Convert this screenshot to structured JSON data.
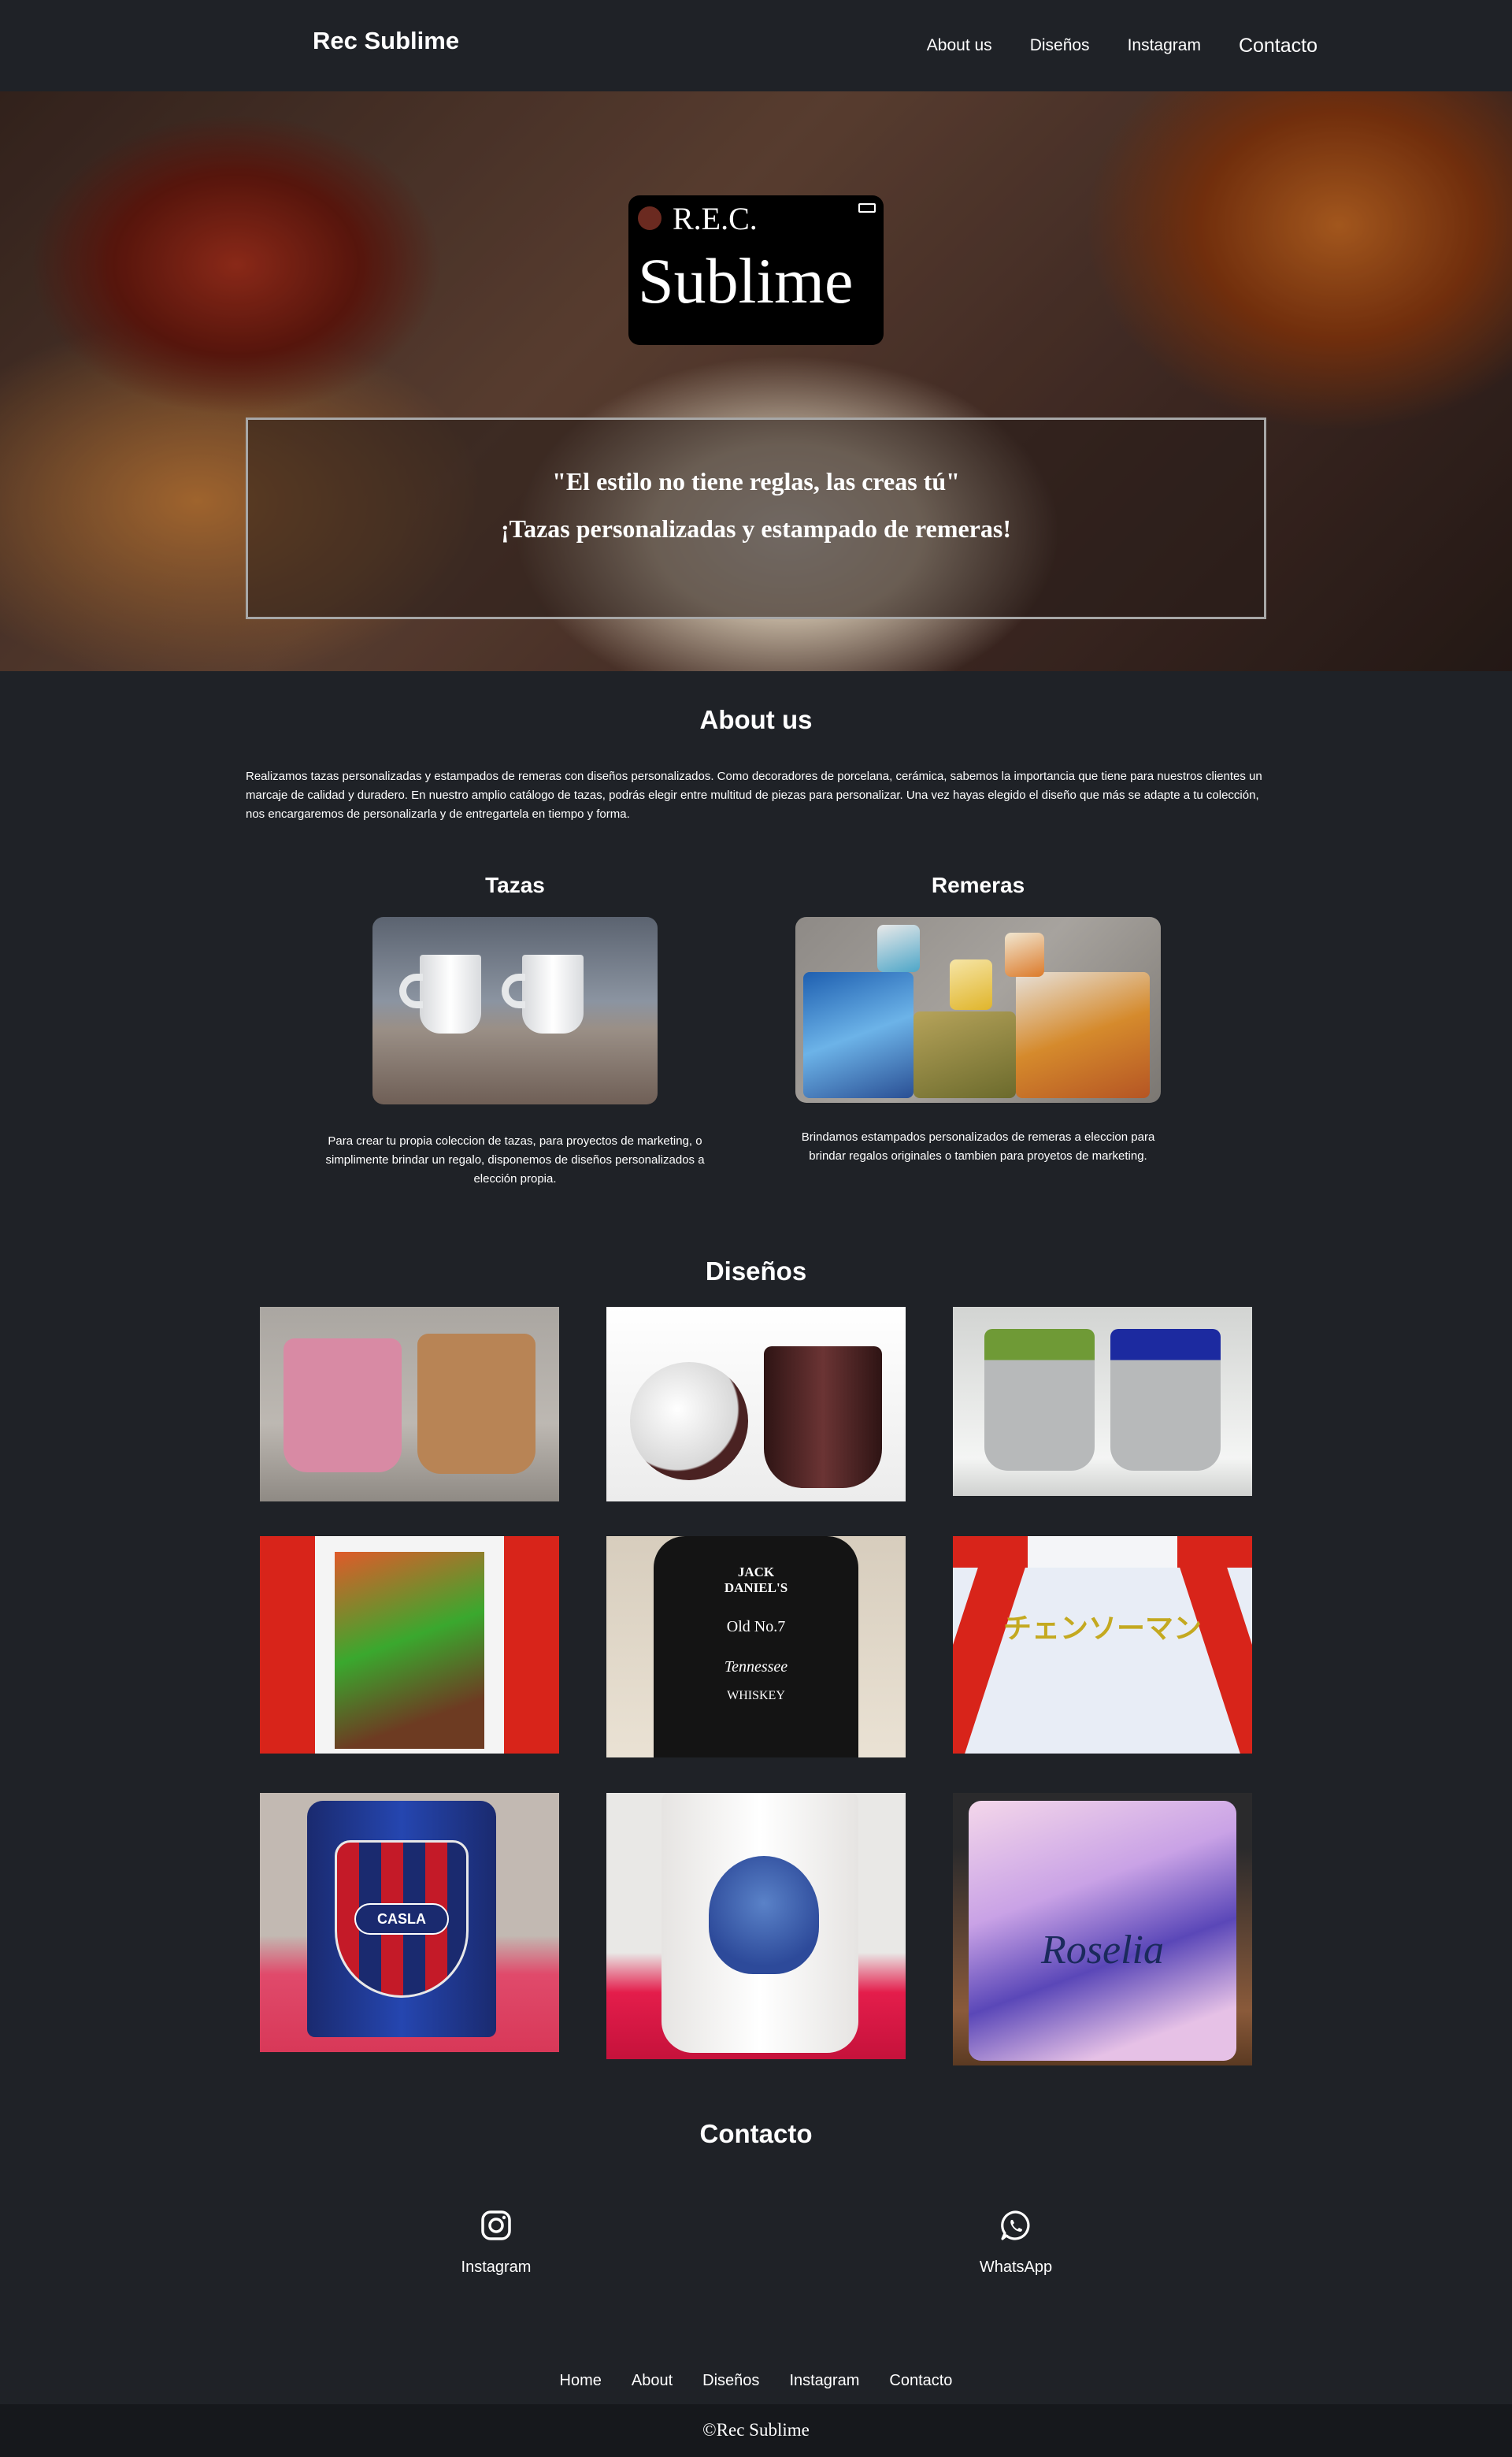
{
  "navbar": {
    "brand": "Rec Sublime",
    "links": [
      "About us",
      "Diseños",
      "Instagram",
      "Contacto"
    ]
  },
  "hero": {
    "logo_small": "R.E.C.",
    "logo_big": "Sublime",
    "tagline_1": "\"El estilo no tiene reglas, las creas tú\"",
    "tagline_2": "¡Tazas personalizadas y estampado de remeras!"
  },
  "about": {
    "title": "About us",
    "text": "Realizamos tazas personalizadas y estampados de remeras con diseños personalizados. Como decoradores de porcelana, cerámica, sabemos la importancia que tiene para nuestros clientes un marcaje de calidad y duradero. En nuestro amplio catálogo de tazas, podrás elegir entre multitud de piezas para personalizar. Una vez hayas elegido el diseño que más se adapte a tu colección, nos encargaremos de personalizarla y de entregartela en tiempo y forma.",
    "tazas": {
      "title": "Tazas",
      "text": "Para crear tu propia coleccion de tazas, para proyectos de marketing, o simplimente brindar un regalo, disponemos de diseños personalizados a elección propia."
    },
    "remeras": {
      "title": "Remeras",
      "text": "Brindamos estampados personalizados de remeras a eleccion para brindar regalos originales o tambien para proyetos de marketing."
    }
  },
  "disenos": {
    "title": "Diseños",
    "gallery_text": {
      "jack_line1": "JACK DANIEL'S",
      "jack_line2": "Old No.7",
      "jack_line3": "Tennessee",
      "jack_line4": "WHISKEY",
      "katakana": "チェンソーマン",
      "casla": "CASLA",
      "roselia": "Roselia"
    },
    "colors": {
      "pink_mug": "#d88aa4",
      "cork_mug": "#b88455",
      "brown_mug": "#4a2222",
      "green_inner": "#6f9a36",
      "blue_inner": "#1c2aa0",
      "red_sleeve": "#d8241a"
    }
  },
  "contacto": {
    "title": "Contacto",
    "items": [
      {
        "label": "Instagram",
        "icon": "instagram-icon"
      },
      {
        "label": "WhatsApp",
        "icon": "whatsapp-icon"
      }
    ]
  },
  "footer": {
    "links": [
      "Home",
      "About",
      "Diseños",
      "Instagram",
      "Contacto"
    ],
    "copyright": "©Rec Sublime"
  }
}
